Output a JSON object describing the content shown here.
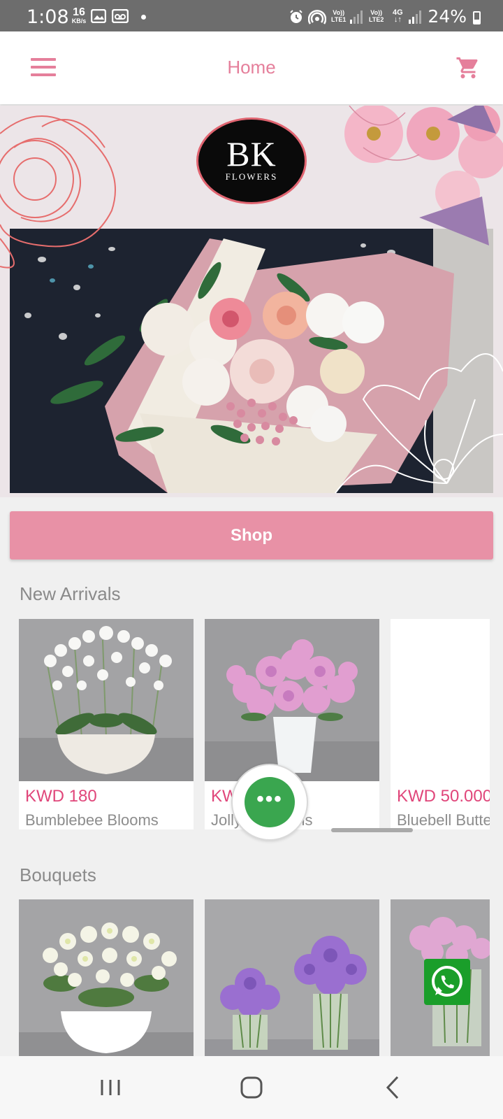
{
  "status_bar": {
    "time": "1:08",
    "speed_value": "16",
    "speed_unit": "KB/s",
    "net1_top": "Vo))",
    "net1_bottom": "LTE1",
    "net2_top": "Vo))",
    "net2_bottom": "LTE2",
    "net_4g": "4G",
    "battery": "24%"
  },
  "app_bar": {
    "title": "Home",
    "menu_icon": "hamburger-menu-icon",
    "cart_icon": "shopping-cart-icon"
  },
  "banner": {
    "logo_main": "BK",
    "logo_sub": "FLOWERS"
  },
  "shop_button": {
    "label": "Shop"
  },
  "new_arrivals": {
    "title": "New Arrivals",
    "items": [
      {
        "price": "KWD 180",
        "name": "Bumblebee Blooms"
      },
      {
        "price": "KWD 50.000",
        "name": "Jolly Blossoms"
      },
      {
        "price": "KWD 50.000",
        "name": "Bluebell Butterfly"
      }
    ]
  },
  "bouquets": {
    "title": "Bouquets"
  },
  "fab": {
    "icon": "more-dots-icon",
    "dots": "•••"
  },
  "whatsapp": {
    "icon": "whatsapp-icon"
  },
  "colors": {
    "accent": "#e57f9b",
    "shop_button": "#e891a6",
    "price": "#e0467a",
    "whatsapp": "#1a9e2a",
    "chat": "#3aa64f"
  }
}
